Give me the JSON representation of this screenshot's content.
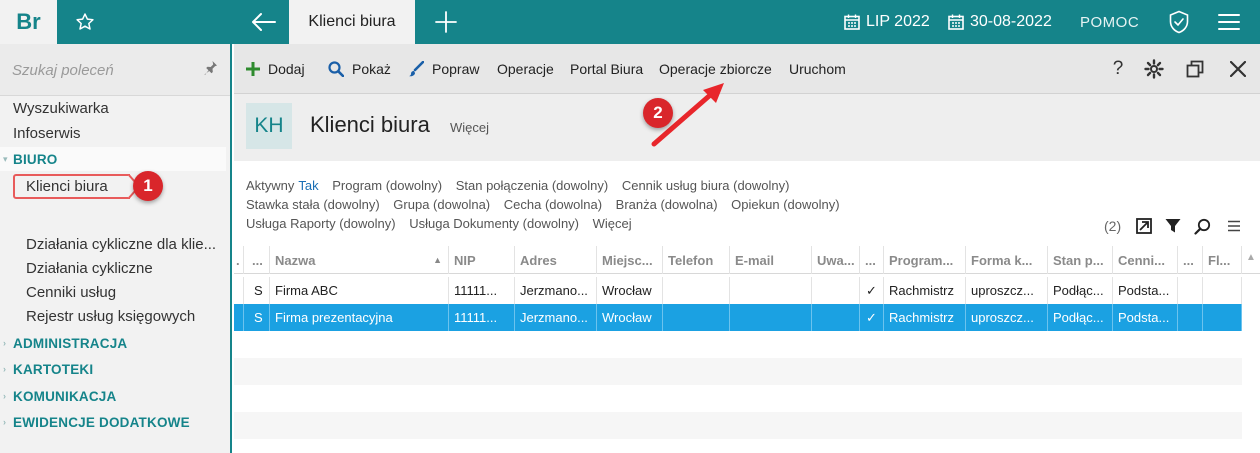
{
  "topbar": {
    "logo": "Br",
    "tab_title": "Klienci biura",
    "year_label": "LIP 2022",
    "date_label": "30-08-2022",
    "help_label": "POMOC"
  },
  "sidebar": {
    "search_placeholder": "Szukaj poleceń",
    "items": [
      {
        "label": "Wyszukiwarka"
      },
      {
        "label": "Infoserwis"
      },
      {
        "label": "BIURO"
      },
      {
        "label": "Klienci biura"
      },
      {
        "label": "Działania cykliczne dla klie..."
      },
      {
        "label": "Działania cykliczne"
      },
      {
        "label": "Cenniki usług"
      },
      {
        "label": "Rejestr usług księgowych"
      },
      {
        "label": "ADMINISTRACJA"
      },
      {
        "label": "KARTOTEKI"
      },
      {
        "label": "KOMUNIKACJA"
      },
      {
        "label": "EWIDENCJE DODATKOWE"
      }
    ]
  },
  "toolbar": {
    "add": "Dodaj",
    "show": "Pokaż",
    "edit": "Popraw",
    "operations": "Operacje",
    "portal": "Portal Biura",
    "bulk_operations": "Operacje zbiorcze",
    "run": "Uruchom",
    "help": "?"
  },
  "header": {
    "badge": "KH",
    "title": "Klienci biura",
    "more": "Więcej"
  },
  "filters": {
    "row1": [
      {
        "label": "Aktywny",
        "value": "Tak"
      },
      {
        "label": "Program (dowolny)"
      },
      {
        "label": "Stan połączenia (dowolny)"
      },
      {
        "label": "Cennik usług biura (dowolny)"
      }
    ],
    "row2": [
      {
        "label": "Stawka stała (dowolny)"
      },
      {
        "label": "Grupa (dowolna)"
      },
      {
        "label": "Cecha (dowolna)"
      },
      {
        "label": "Branża (dowolna)"
      },
      {
        "label": "Opiekun (dowolny)"
      }
    ],
    "row3": [
      {
        "label": "Usługa Raporty (dowolny)"
      },
      {
        "label": "Usługa Dokumenty (dowolny)"
      },
      {
        "label": "Więcej"
      }
    ],
    "count": "(2)"
  },
  "table": {
    "columns": [
      ".",
      "...",
      "Nazwa",
      "NIP",
      "Adres",
      "Miejsc...",
      "Telefon",
      "E-mail",
      "Uwa...",
      "...",
      "Program...",
      "Forma k...",
      "Stan p...",
      "Cenni...",
      "...",
      "Fl..."
    ],
    "rows": [
      [
        "",
        "S",
        "Firma ABC",
        "11111...",
        "Jerzmano...",
        "Wrocław",
        "",
        "",
        "",
        "✓",
        "Rachmistrz",
        "uproszcz...",
        "Podłąc...",
        "Podsta...",
        "",
        ""
      ],
      [
        "",
        "S",
        "Firma prezentacyjna",
        "11111...",
        "Jerzmano...",
        "Wrocław",
        "",
        "",
        "",
        "✓",
        "Rachmistrz",
        "uproszcz...",
        "Podłąc...",
        "Podsta...",
        "",
        ""
      ]
    ],
    "selected_row": 1
  },
  "annotations": {
    "marker1": "1",
    "marker2": "2"
  },
  "colors": {
    "brand": "#15848a",
    "selection": "#1ba1e2",
    "marker": "#d9262b"
  }
}
